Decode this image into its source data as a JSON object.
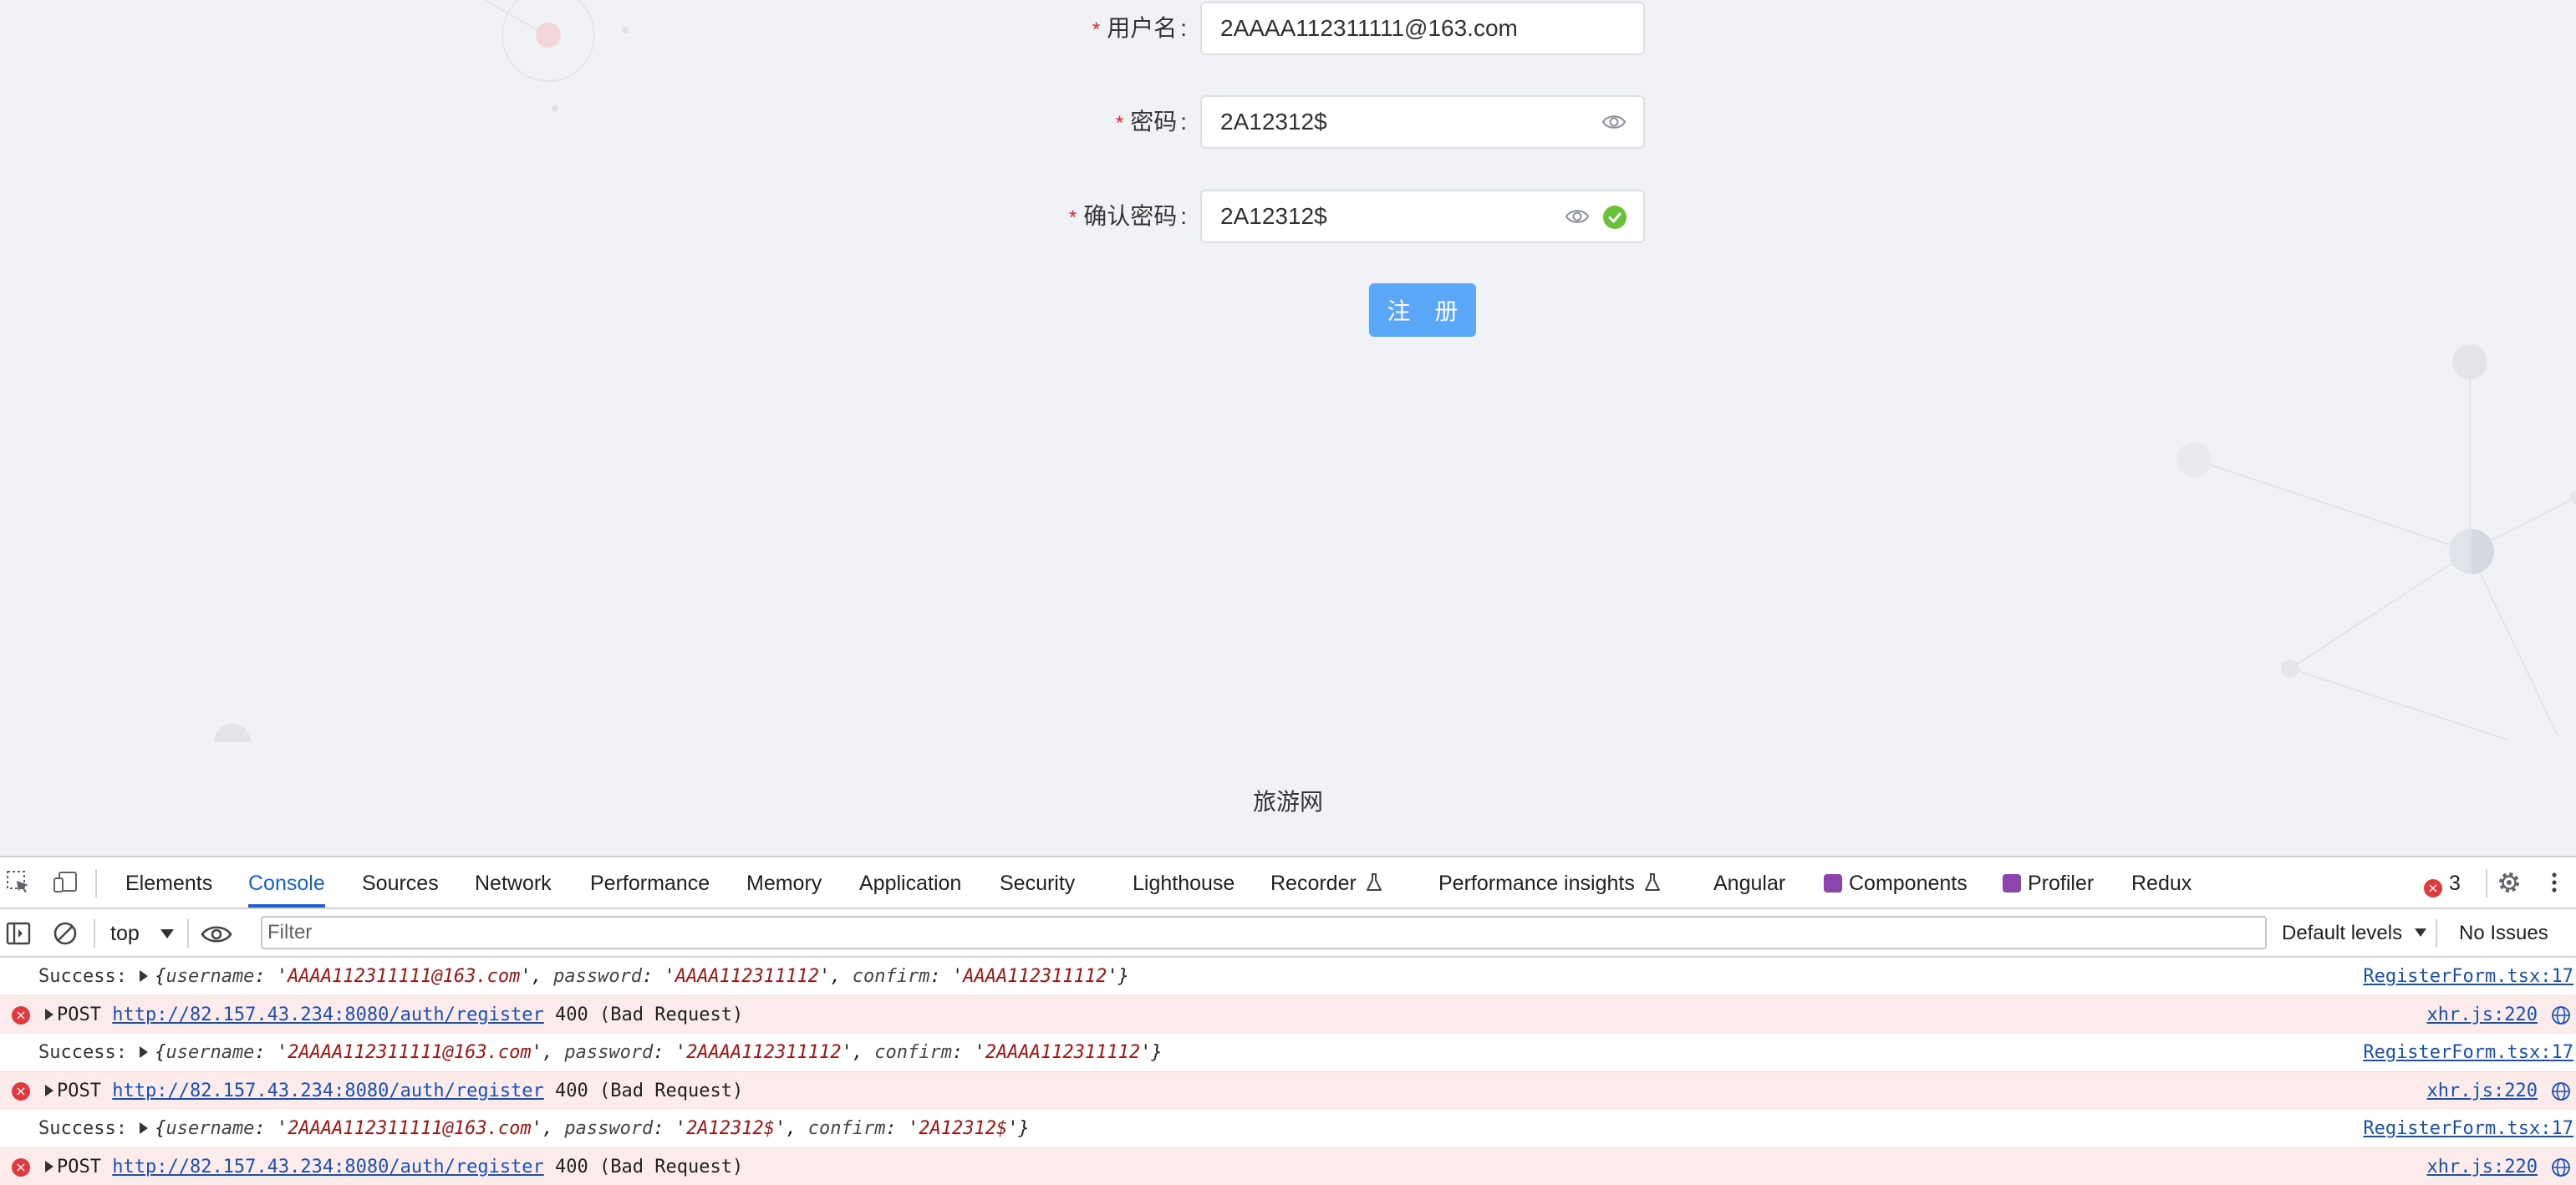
{
  "form": {
    "username": {
      "required_mark": "*",
      "label": "用户名",
      "colon": ":",
      "value": "2AAAA112311111@163.com"
    },
    "password": {
      "required_mark": "*",
      "label": "密码",
      "colon": ":",
      "value": "2A12312$"
    },
    "confirm": {
      "required_mark": "*",
      "label": "确认密码",
      "colon": ":",
      "value": "2A12312$"
    },
    "submit_label": "注 册"
  },
  "footer_text": "旅游网",
  "devtools": {
    "tabs": [
      "Elements",
      "Console",
      "Sources",
      "Network",
      "Performance",
      "Memory",
      "Application",
      "Security",
      "Lighthouse",
      "Recorder",
      "Performance insights",
      "Angular",
      "Components",
      "Profiler",
      "Redux"
    ],
    "active_tab": "Console",
    "error_count": "3",
    "context": "top",
    "filter_placeholder": "Filter",
    "levels": "Default levels",
    "issues": "No Issues",
    "colors": {
      "accent": "#1a5fd3",
      "error": "#e0393e",
      "error_bg": "#fcebeb",
      "success": "#67c23a",
      "button": "#5aa7f7"
    }
  },
  "console": [
    {
      "kind": "log",
      "prefix": "Success:",
      "username": "AAAA112311111@163.com",
      "password": "AAAA112311112",
      "confirm": "AAAA112311112",
      "source": "RegisterForm.tsx:17"
    },
    {
      "kind": "error",
      "method": "POST",
      "url": "http://82.157.43.234:8080/auth/register",
      "status": "400 (Bad Request)",
      "source": "xhr.js:220"
    },
    {
      "kind": "log",
      "prefix": "Success:",
      "username": "2AAAA112311111@163.com",
      "password": "2AAAA112311112",
      "confirm": "2AAAA112311112",
      "source": "RegisterForm.tsx:17"
    },
    {
      "kind": "error",
      "method": "POST",
      "url": "http://82.157.43.234:8080/auth/register",
      "status": "400 (Bad Request)",
      "source": "xhr.js:220"
    },
    {
      "kind": "log",
      "prefix": "Success:",
      "username": "2AAAA112311111@163.com",
      "password": "2A12312$",
      "confirm": "2A12312$",
      "source": "RegisterForm.tsx:17"
    },
    {
      "kind": "error",
      "method": "POST",
      "url": "http://82.157.43.234:8080/auth/register",
      "status": "400 (Bad Request)",
      "source": "xhr.js:220"
    }
  ]
}
